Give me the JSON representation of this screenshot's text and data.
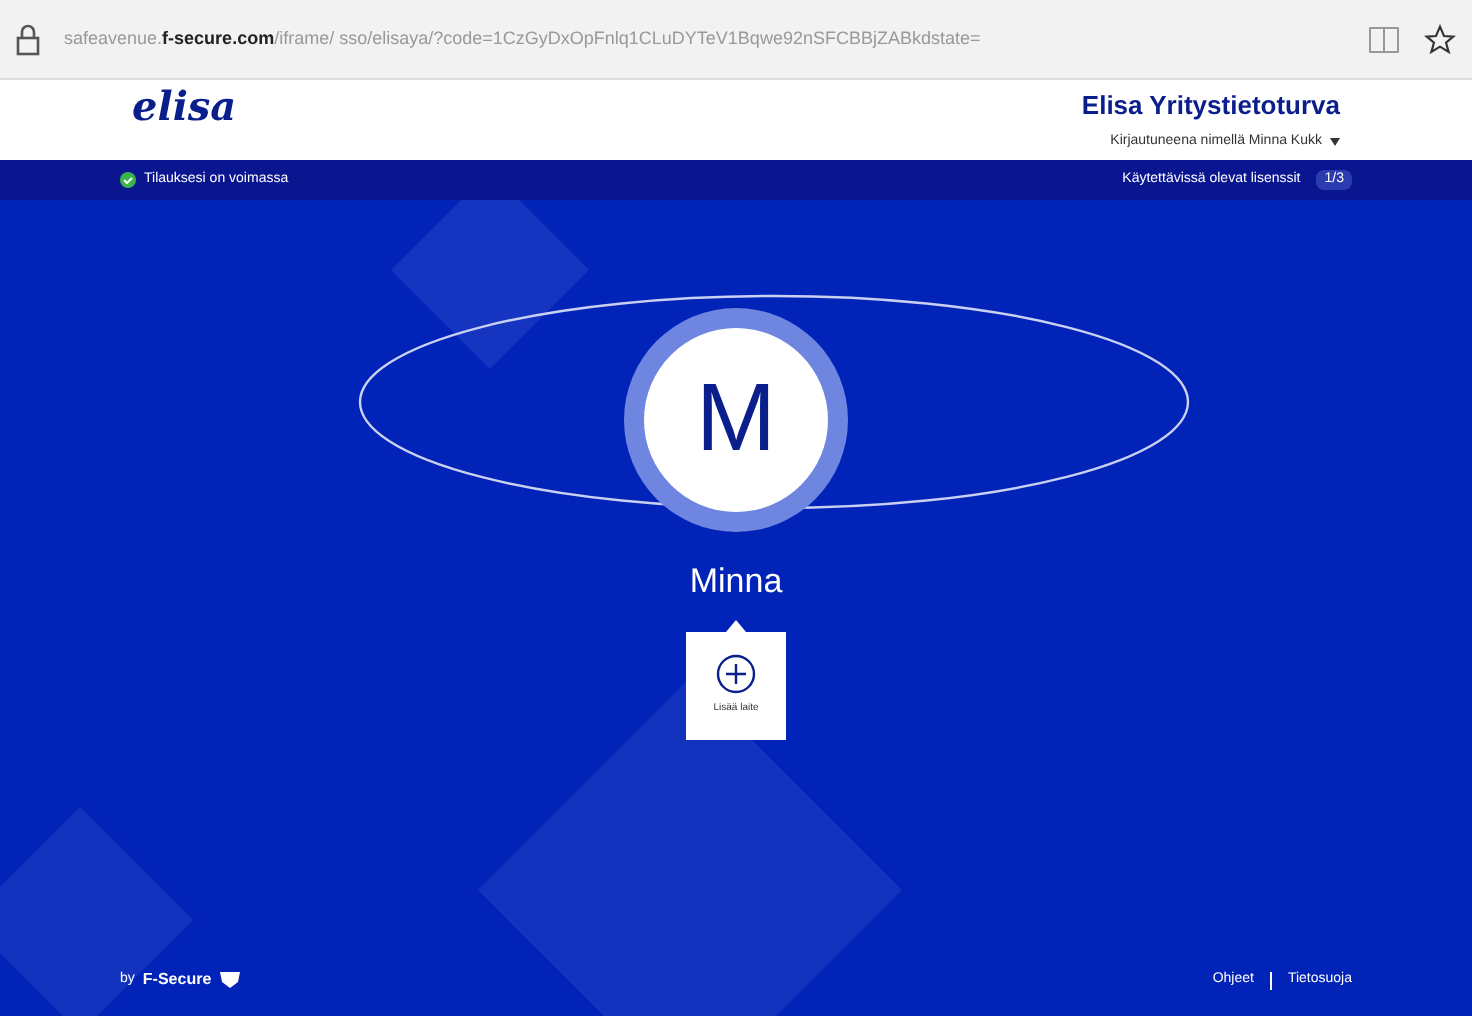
{
  "browser": {
    "url_domain": "f-secure.com",
    "url_prefix": "safeavenue.",
    "url_rest": "/iframe/ sso/elisaya/?code=1CzGyDxOpFnlq1CLuDYTeV1Bqwe92nSFCBBjZABkdstate="
  },
  "header": {
    "logo": "elisa",
    "title": "Elisa Yritystietoturva",
    "user_menu": "Kirjautuneena nimellä Minna Kukk"
  },
  "status_bar": {
    "subscription": "Tilauksesi on voimassa",
    "licenses_label": "Käytettävissä olevat lisenssit",
    "licenses_count": "1/3"
  },
  "profile": {
    "initial": "M",
    "name": "Minna",
    "add_device": "Lisää laite"
  },
  "footer": {
    "brand_prefix": "by",
    "brand": "F-Secure",
    "links": [
      "Ohjeet",
      "Tietosuoja"
    ]
  }
}
